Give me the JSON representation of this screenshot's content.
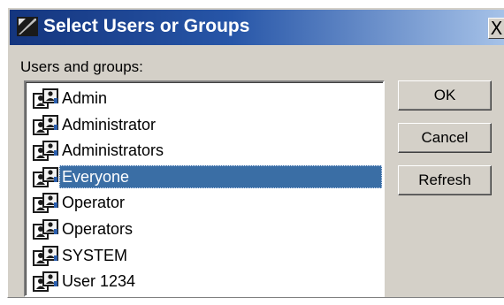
{
  "dialog": {
    "title": "Select Users or Groups",
    "close_label": "X"
  },
  "list": {
    "label": "Users and groups:",
    "items": [
      {
        "label": "Admin",
        "icon": "user-group-icon",
        "selected": false
      },
      {
        "label": "Administrator",
        "icon": "user-group-icon",
        "selected": false
      },
      {
        "label": "Administrators",
        "icon": "user-group-icon",
        "selected": false
      },
      {
        "label": "Everyone",
        "icon": "user-group-icon",
        "selected": true
      },
      {
        "label": "Operator",
        "icon": "user-group-icon",
        "selected": false
      },
      {
        "label": "Operators",
        "icon": "user-group-icon",
        "selected": false
      },
      {
        "label": "SYSTEM",
        "icon": "user-group-icon",
        "selected": false
      },
      {
        "label": "User 1234",
        "icon": "user-group-icon",
        "selected": false
      }
    ]
  },
  "buttons": {
    "ok_label": "OK",
    "cancel_label": "Cancel",
    "refresh_label": "Refresh"
  },
  "colors": {
    "titlebar_start": "#14357e",
    "titlebar_end": "#a6c2e8",
    "selection": "#3a6ea5",
    "dialog_face": "#d4d0c8"
  }
}
